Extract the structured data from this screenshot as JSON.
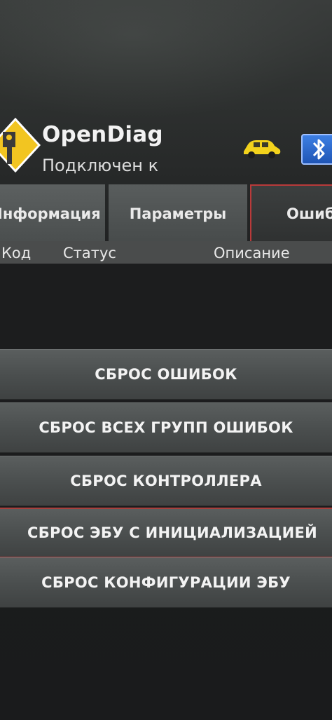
{
  "app": {
    "title": "OpenDiag",
    "status": "Подключен к"
  },
  "tabs": [
    {
      "label": "Информация",
      "active": false
    },
    {
      "label": "Параметры",
      "active": false
    },
    {
      "label": "Ошиб",
      "active": true
    }
  ],
  "table": {
    "columns": [
      "Код",
      "Статус",
      "Описание"
    ],
    "rows": []
  },
  "actions": [
    {
      "label": "СБРОС ОШИБОК"
    },
    {
      "label": "СБРОС ВСЕХ ГРУПП ОШИБОК"
    },
    {
      "label": "СБРОС КОНТРОЛЛЕРА"
    },
    {
      "label": "СБРОС ЭБУ С ИНИЦИАЛИЗАЦИЕЙ"
    },
    {
      "label": "СБРОС КОНФИГУРАЦИИ ЭБУ"
    }
  ],
  "icons": {
    "logo": "opendiag-logo-icon",
    "car": "car-icon",
    "bluetooth": "bluetooth-icon"
  },
  "colors": {
    "accent_yellow": "#f2c521",
    "active_tab_border": "#b93a3a",
    "bluetooth_blue": "#2f6fd8"
  }
}
